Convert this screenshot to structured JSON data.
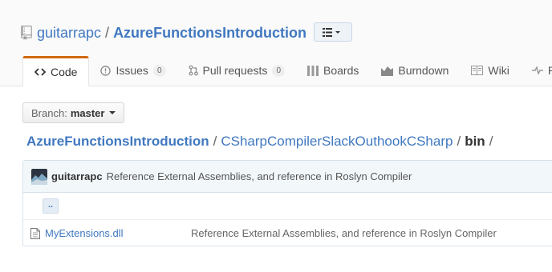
{
  "repo": {
    "owner": "guitarrapc",
    "separator": "/",
    "name": "AzureFunctionsIntroduction"
  },
  "tabs": [
    {
      "label": "Code",
      "icon": "code-icon"
    },
    {
      "label": "Issues",
      "count": "0",
      "icon": "issue-icon"
    },
    {
      "label": "Pull requests",
      "count": "0",
      "icon": "pull-request-icon"
    },
    {
      "label": "Boards",
      "icon": "boards-icon"
    },
    {
      "label": "Burndown",
      "icon": "burndown-icon"
    },
    {
      "label": "Wiki",
      "icon": "wiki-icon"
    },
    {
      "label": "Pu",
      "icon": "pulse-icon"
    }
  ],
  "branch": {
    "label": "Branch:",
    "value": "master"
  },
  "breadcrumb": {
    "root": "AzureFunctionsIntroduction",
    "sep1": "/",
    "folder": "CSharpCompilerSlackOuthookCSharp",
    "sep2": "/",
    "current": "bin",
    "sep3": "/"
  },
  "commit": {
    "author": "guitarrapc",
    "message": "Reference External Assemblies, and reference in Roslyn Compiler"
  },
  "files": {
    "up_label": "..",
    "items": [
      {
        "name": "MyExtensions.dll",
        "message": "Reference External Assemblies, and reference in Roslyn Compiler"
      }
    ]
  },
  "colors": {
    "link": "#4078c0",
    "tab_accent": "#d26911",
    "commit_bar": "#f2f8fa"
  }
}
